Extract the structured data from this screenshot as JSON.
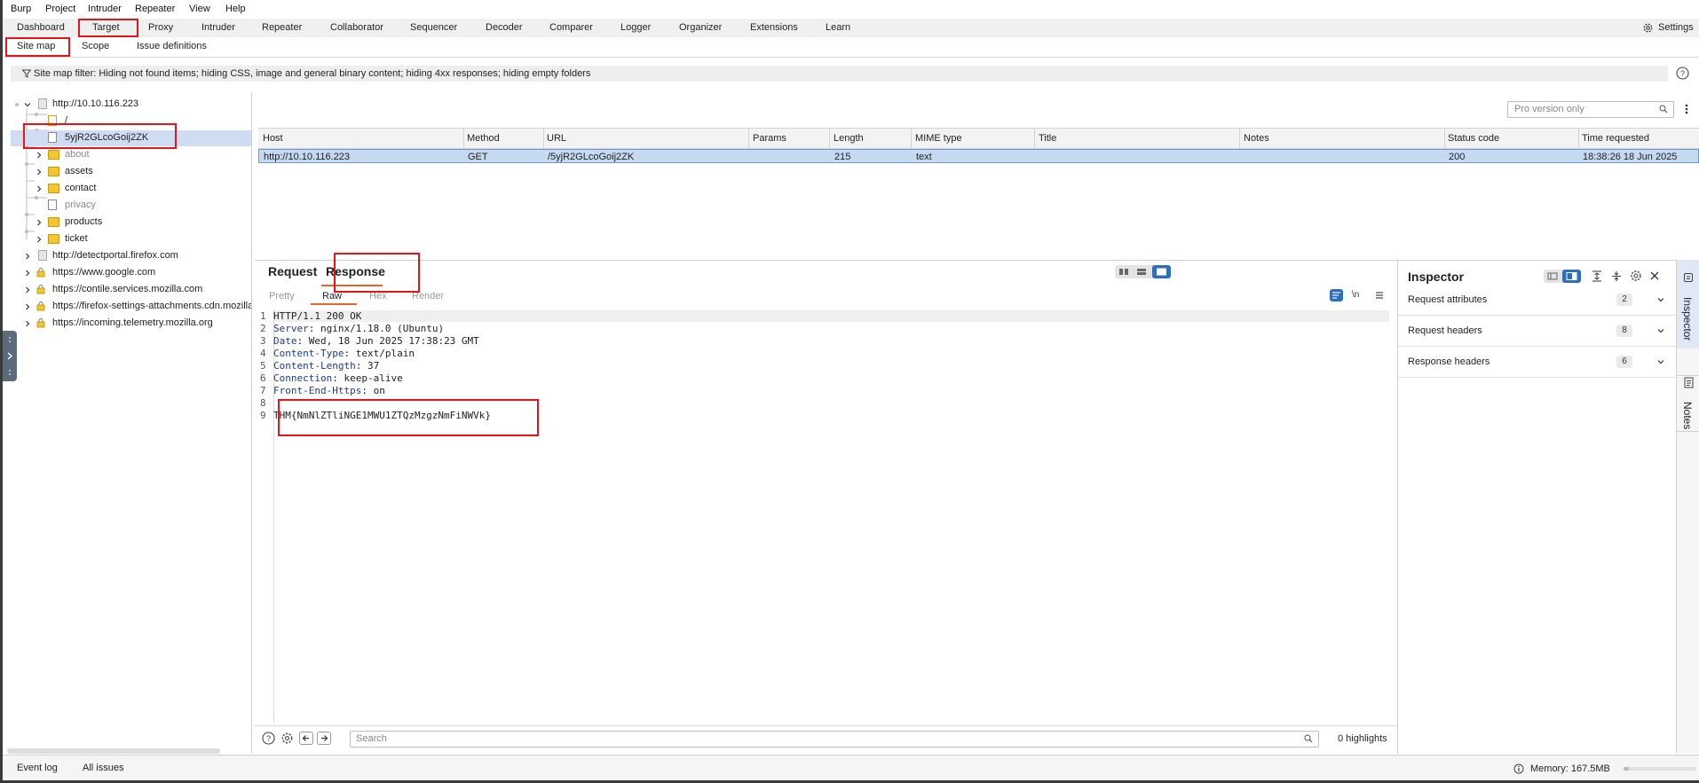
{
  "menu": [
    "Burp",
    "Project",
    "Intruder",
    "Repeater",
    "View",
    "Help"
  ],
  "main_tabs": [
    "Dashboard",
    "Target",
    "Proxy",
    "Intruder",
    "Repeater",
    "Collaborator",
    "Sequencer",
    "Decoder",
    "Comparer",
    "Logger",
    "Organizer",
    "Extensions",
    "Learn"
  ],
  "settings_label": "Settings",
  "sub_tabs": [
    "Site map",
    "Scope",
    "Issue definitions"
  ],
  "filter_text": "Site map filter: Hiding not found items; hiding CSS, image and general binary content; hiding 4xx responses; hiding empty folders",
  "tree": {
    "root": "http://10.10.116.223",
    "children": [
      "/",
      "5yjR2GLcoGoij2ZK",
      "about",
      "assets",
      "contact",
      "privacy",
      "products",
      "ticket"
    ],
    "hosts": [
      "http://detectportal.firefox.com",
      "https://www.google.com",
      "https://contile.services.mozilla.com",
      "https://firefox-settings-attachments.cdn.mozilla",
      "https://incoming.telemetry.mozilla.org"
    ]
  },
  "table_search_placeholder": "Pro version only",
  "table": {
    "columns": [
      "Host",
      "Method",
      "URL",
      "Params",
      "Length",
      "MIME type",
      "Title",
      "Notes",
      "Status code",
      "Time requested"
    ],
    "rows": [
      [
        "http://10.10.116.223",
        "GET",
        "/5yjR2GLcoGoij2ZK",
        "",
        "215",
        "text",
        "",
        "",
        "200",
        "18:38:26 18 Jun 2025"
      ]
    ]
  },
  "rr": {
    "tabs": [
      "Request",
      "Response"
    ],
    "subtabs": [
      "Pretty",
      "Raw",
      "Hex",
      "Render"
    ],
    "newline_label": "\\n",
    "lines": [
      {
        "n": "1",
        "key": "",
        "val": "HTTP/1.1 200 OK"
      },
      {
        "n": "2",
        "key": "Server",
        "val": ": nginx/1.18.0 (Ubuntu)"
      },
      {
        "n": "3",
        "key": "Date",
        "val": ": Wed, 18 Jun 2025 17:38:23 GMT"
      },
      {
        "n": "4",
        "key": "Content-Type",
        "val": ": text/plain"
      },
      {
        "n": "5",
        "key": "Content-Length",
        "val": ": 37"
      },
      {
        "n": "6",
        "key": "Connection",
        "val": ": keep-alive"
      },
      {
        "n": "7",
        "key": "Front-End-Https",
        "val": ": on"
      },
      {
        "n": "8",
        "key": "",
        "val": ""
      },
      {
        "n": "9",
        "key": "",
        "val": "THM{NmNlZTliNGE1MWU1ZTQzMzgzNmFiNWVk}"
      }
    ],
    "search_placeholder": "Search",
    "highlights": "0 highlights"
  },
  "inspector": {
    "title": "Inspector",
    "rows": [
      {
        "label": "Request attributes",
        "count": "2"
      },
      {
        "label": "Request headers",
        "count": "8"
      },
      {
        "label": "Response headers",
        "count": "6"
      }
    ]
  },
  "rail": [
    "Inspector",
    "Notes"
  ],
  "status": {
    "event_log": "Event log",
    "all_issues": "All issues",
    "memory": "Memory: 167.5MB"
  },
  "colors": {
    "highlight": "#e5141a",
    "selected_row": "#c5d9f1",
    "accent_tab": "#e8622c"
  }
}
